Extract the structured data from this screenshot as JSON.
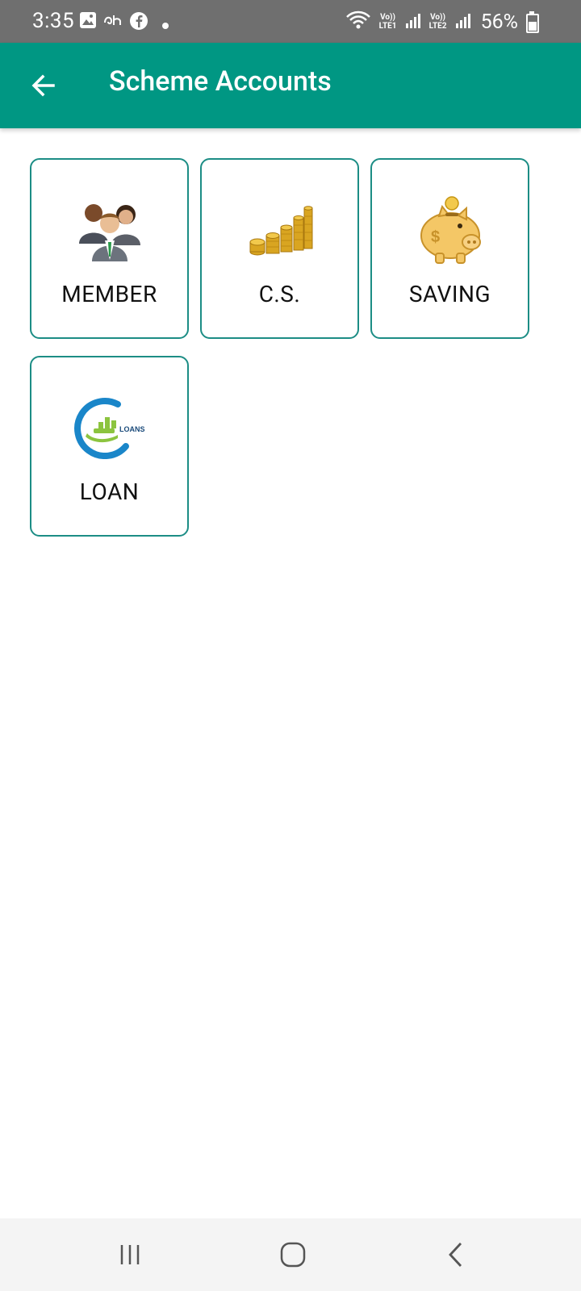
{
  "status_bar": {
    "time": "3:35",
    "lte1": "Vo)) LTE1",
    "lte2": "Vo)) LTE2",
    "battery_text": "56%",
    "battery_level": 0.56
  },
  "app_bar": {
    "title": "Scheme Accounts",
    "color": "#009783"
  },
  "tiles": [
    {
      "label": "MEMBER",
      "icon": "people-group-icon"
    },
    {
      "label": "C.S.",
      "icon": "coin-stacks-icon"
    },
    {
      "label": "SAVING",
      "icon": "piggy-bank-icon"
    },
    {
      "label": "LOAN",
      "icon": "loans-logo-icon",
      "icon_text": "LOANS"
    }
  ],
  "colors": {
    "tile_border": "#1c8d85",
    "accent": "#009783"
  }
}
